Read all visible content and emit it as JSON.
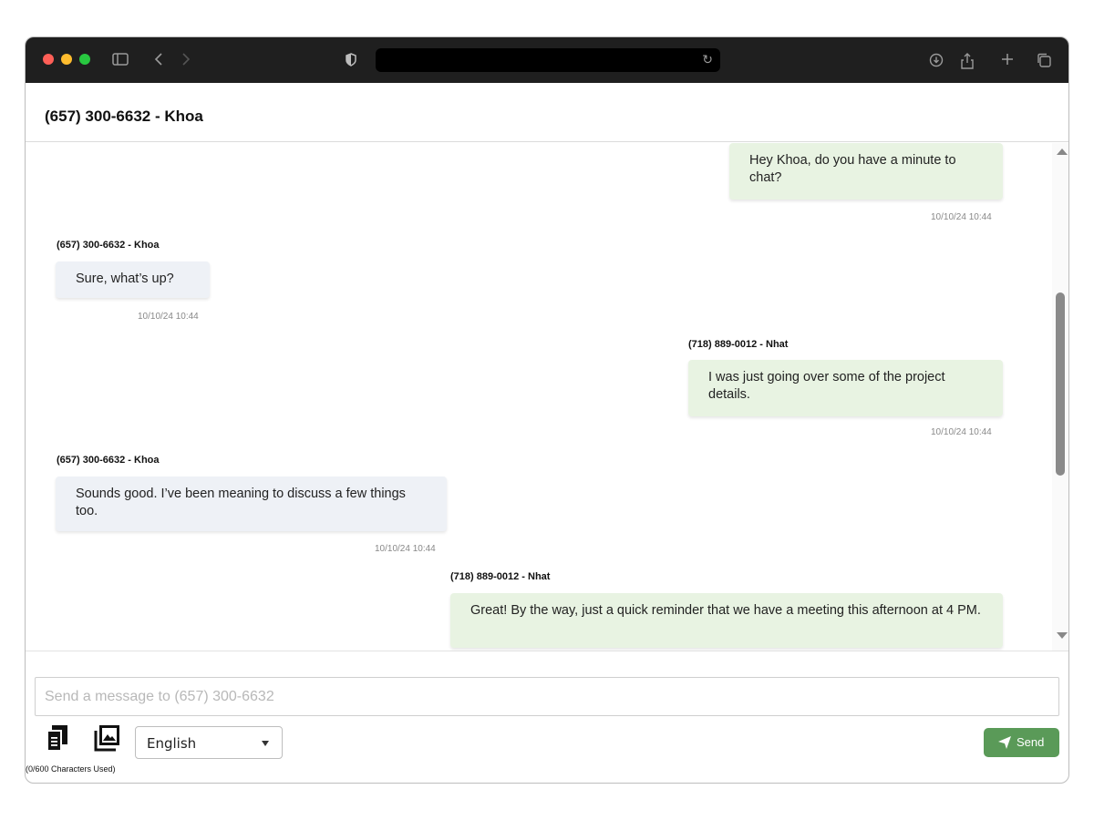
{
  "window": {
    "traffic_lights": [
      "#ff5f57",
      "#febc2e",
      "#28c840"
    ],
    "address_bar": ""
  },
  "chat": {
    "title": "(657) 300-6632 - Khoa"
  },
  "messages": [
    {
      "direction": "out",
      "sender": "",
      "text": "Hey Khoa, do you have a minute to chat?",
      "timestamp": "10/10/24 10:44"
    },
    {
      "direction": "in",
      "sender": "(657) 300-6632 - Khoa",
      "text": "Sure, what’s up?",
      "timestamp": "10/10/24 10:44"
    },
    {
      "direction": "out",
      "sender": "(718) 889-0012 - Nhat",
      "text": "I was just going over some of the project details.",
      "timestamp": "10/10/24 10:44"
    },
    {
      "direction": "in",
      "sender": "(657) 300-6632 - Khoa",
      "text": "Sounds good. I’ve been meaning to discuss a few things too.",
      "timestamp": "10/10/24 10:44"
    },
    {
      "direction": "out",
      "sender": "(718) 889-0012 - Nhat",
      "text": "Great! By the way, just a quick reminder that we have a meeting this afternoon at 4 PM.",
      "timestamp": ""
    }
  ],
  "composer": {
    "placeholder": "Send a message to (657) 300-6632",
    "value": "",
    "language": "English",
    "char_count": "(0/600 Characters Used)",
    "send_label": "Send"
  },
  "colors": {
    "incoming_bubble": "#eef1f6",
    "outgoing_bubble": "#e8f3e2",
    "send_button": "#5a9a58"
  },
  "icons": [
    "sidebar-icon",
    "back-icon",
    "forward-icon",
    "shield-icon",
    "reload-icon",
    "download-icon",
    "share-icon",
    "new-tab-icon",
    "tabs-icon",
    "templates-icon",
    "image-gallery-icon",
    "send-icon"
  ]
}
